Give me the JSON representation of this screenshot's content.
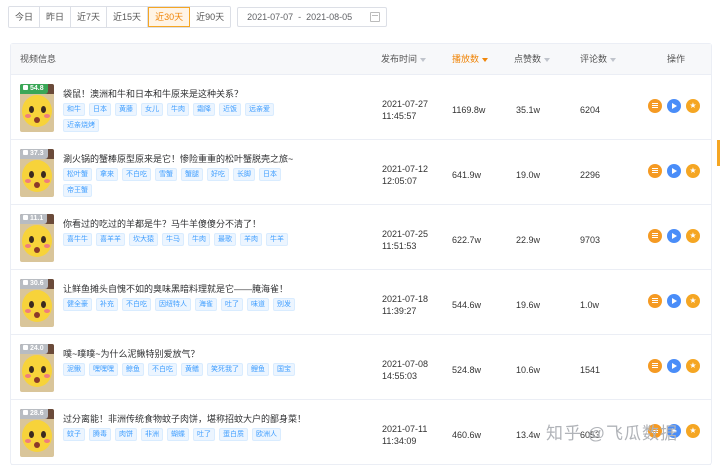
{
  "range_buttons": [
    {
      "label": "今日",
      "active": false
    },
    {
      "label": "昨日",
      "active": false
    },
    {
      "label": "近7天",
      "active": false
    },
    {
      "label": "近15天",
      "active": false
    },
    {
      "label": "近30天",
      "active": true
    },
    {
      "label": "近90天",
      "active": false
    }
  ],
  "date_range": {
    "start": "2021-07-07",
    "separator": "-",
    "end": "2021-08-05"
  },
  "columns": {
    "video_info": "视频信息",
    "publish_time": "发布时间",
    "plays": "播放数",
    "likes": "点赞数",
    "comments": "评论数",
    "actions": "操作"
  },
  "rows": [
    {
      "score": "54.8",
      "badge": "green",
      "title": "袋鼠！澳洲和牛和日本和牛原来是这种关系？",
      "tags": [
        "和牛",
        "日本",
        "黄藤",
        "女儿",
        "牛肉",
        "霜降",
        "近饭",
        "远亲爱",
        "近亲烧烤"
      ],
      "date": "2021-07-27",
      "time": "11:45:57",
      "plays": "1169.8w",
      "likes": "35.1w",
      "comments": "6204"
    },
    {
      "score": "37.3",
      "badge": "grey",
      "title": "涮火锅的蟹棒原型原来是它！惨险重重的松叶蟹脱壳之旅~",
      "tags": [
        "松叶蟹",
        "拿来",
        "不白吃",
        "雪蟹",
        "蟹腿",
        "好吃",
        "长脚",
        "日本",
        "帝王蟹"
      ],
      "date": "2021-07-12",
      "time": "12:05:07",
      "plays": "641.9w",
      "likes": "19.0w",
      "comments": "2296"
    },
    {
      "score": "11.1",
      "badge": "grey",
      "title": "你看过的吃过的羊都是牛？马牛羊傻傻分不清了！",
      "tags": [
        "喜牛牛",
        "喜羊羊",
        "坎大猿",
        "牛马",
        "牛肉",
        "最歌",
        "羊肉",
        "牛羊"
      ],
      "date": "2021-07-25",
      "time": "11:51:53",
      "plays": "622.7w",
      "likes": "22.9w",
      "comments": "9703"
    },
    {
      "score": "30.6",
      "badge": "grey",
      "title": "让鲜鱼摊头自愧不如的臭味黑暗料理就是它——腌海雀！",
      "tags": [
        "健全豪",
        "补充",
        "不白吃",
        "因纽特人",
        "海雀",
        "吐了",
        "味道",
        "别发"
      ],
      "date": "2021-07-18",
      "time": "11:39:27",
      "plays": "544.6w",
      "likes": "19.6w",
      "comments": "1.0w"
    },
    {
      "score": "24.0",
      "badge": "grey",
      "title": "噗~噗噗~为什么泥鳅特别爱放气？",
      "tags": [
        "泥鳅",
        "嘿嘿嘿",
        "鲸鱼",
        "不白吃",
        "黄鳝",
        "笑死我了",
        "鲤鱼",
        "国宝"
      ],
      "date": "2021-07-08",
      "time": "14:55:03",
      "plays": "524.8w",
      "likes": "10.6w",
      "comments": "1541"
    },
    {
      "score": "28.6",
      "badge": "grey",
      "title": "过分离能！非洲传统食物蚊子肉饼，堪称招蚊大户的鄙身菜！",
      "tags": [
        "蚊子",
        "腾毒",
        "肉饼",
        "非洲",
        "蝴蝶",
        "吐了",
        "蛋白质",
        "欧洲人"
      ],
      "date": "2021-07-11",
      "time": "11:34:09",
      "plays": "460.6w",
      "likes": "13.4w",
      "comments": "6053"
    }
  ],
  "watermark": "知乎 @飞瓜数据"
}
